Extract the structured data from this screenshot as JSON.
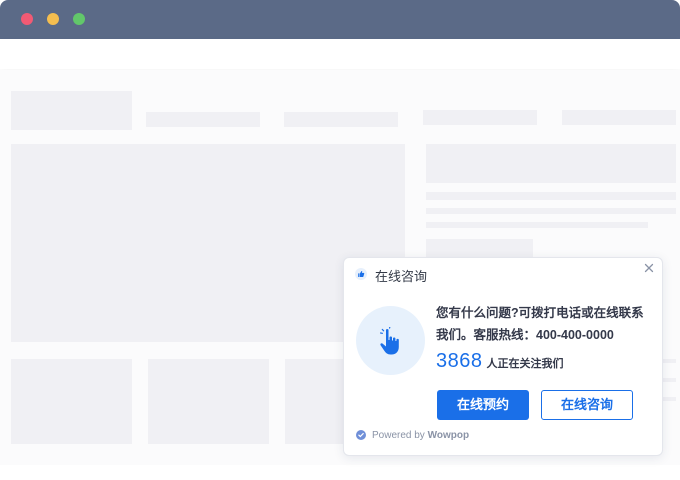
{
  "window": {
    "traffic_lights": [
      {
        "name": "close",
        "color": "#f25a74"
      },
      {
        "name": "minimize",
        "color": "#f5be4f"
      },
      {
        "name": "zoom",
        "color": "#62c76a"
      }
    ],
    "titlebar_color": "#5b6a87"
  },
  "popup": {
    "title": "在线咨询",
    "title_icon": "thumbs-up-icon",
    "close_icon": "close-icon",
    "avatar_icon": "pointing-hand-icon",
    "message": "您有什么问题?可拨打电话或在线联系我们。客服热线：400-400-0000",
    "count": "3868",
    "count_label": "人正在关注我们",
    "primary_button": "在线预约",
    "secondary_button": "在线咨询",
    "powered_by": "Powered by",
    "brand": "Wowpop",
    "accent_color": "#1a6fe8"
  }
}
